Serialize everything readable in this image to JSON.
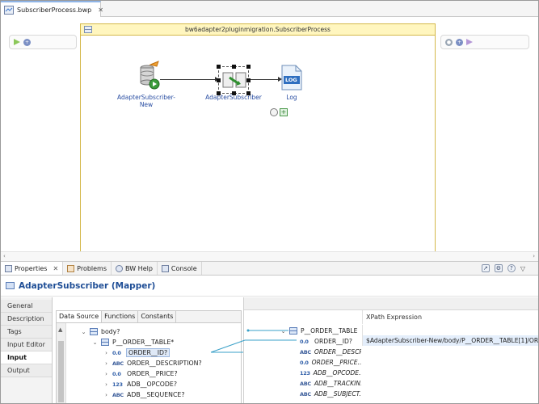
{
  "editor": {
    "tab_title": "SubscriberProcess.bwp",
    "close_glyph": "✕"
  },
  "canvas": {
    "process_name": "bw6adapter2pluginmigration.SubscriberProcess",
    "activities": [
      {
        "label": "AdapterSubscriber-\nNew"
      },
      {
        "label": "AdapterSubscriber"
      },
      {
        "label": "Log"
      }
    ],
    "log_icon_text": "LOG"
  },
  "panel": {
    "tabs": [
      {
        "label": "Properties",
        "close": "✕"
      },
      {
        "label": "Problems"
      },
      {
        "label": "BW Help"
      },
      {
        "label": "Console"
      }
    ]
  },
  "properties": {
    "title": "AdapterSubscriber (Mapper)",
    "side_tabs": [
      "General",
      "Description",
      "Tags",
      "Input Editor",
      "Input",
      "Output"
    ],
    "active_side_tab": "Input"
  },
  "source": {
    "tabs": [
      "Data Source",
      "Functions",
      "Constants"
    ],
    "tree": [
      {
        "label": "body?",
        "type": "",
        "chev": "⌄"
      },
      {
        "label": "P__ORDER__TABLE*",
        "type": "",
        "chev": "⌄"
      },
      {
        "label": "ORDER__ID?",
        "type": "0.0",
        "chev": "›"
      },
      {
        "label": "ORDER__DESCRIPTION?",
        "type": "ABC",
        "chev": "›"
      },
      {
        "label": "ORDER__PRICE?",
        "type": "0.0",
        "chev": "›"
      },
      {
        "label": "ADB__OPCODE?",
        "type": "123",
        "chev": "›"
      },
      {
        "label": "ADB__SEQUENCE?",
        "type": "ABC",
        "chev": "›"
      }
    ]
  },
  "target": {
    "xpath_header": "XPath Expression",
    "tree": [
      {
        "label": "P__ORDER__TABLE",
        "type": ""
      },
      {
        "label": "ORDER__ID?",
        "type": "0.0"
      },
      {
        "label": "ORDER__DESCR...",
        "type": "ABC"
      },
      {
        "label": "ORDER__PRICE...",
        "type": "0.0"
      },
      {
        "label": "ADB__OPCODE...",
        "type": "123"
      },
      {
        "label": "ADB__TRACKIN...",
        "type": "ABC"
      },
      {
        "label": "ADB__SUBJECT...",
        "type": "ABC"
      }
    ],
    "xpath_values": [
      "",
      "$AdapterSubscriber-New/body/P__ORDER__TABLE[1]/OR"
    ]
  },
  "colors": {
    "accent": "#1f4e96",
    "process_border": "#d4b84a",
    "process_title_bg": "#fff6bf"
  }
}
